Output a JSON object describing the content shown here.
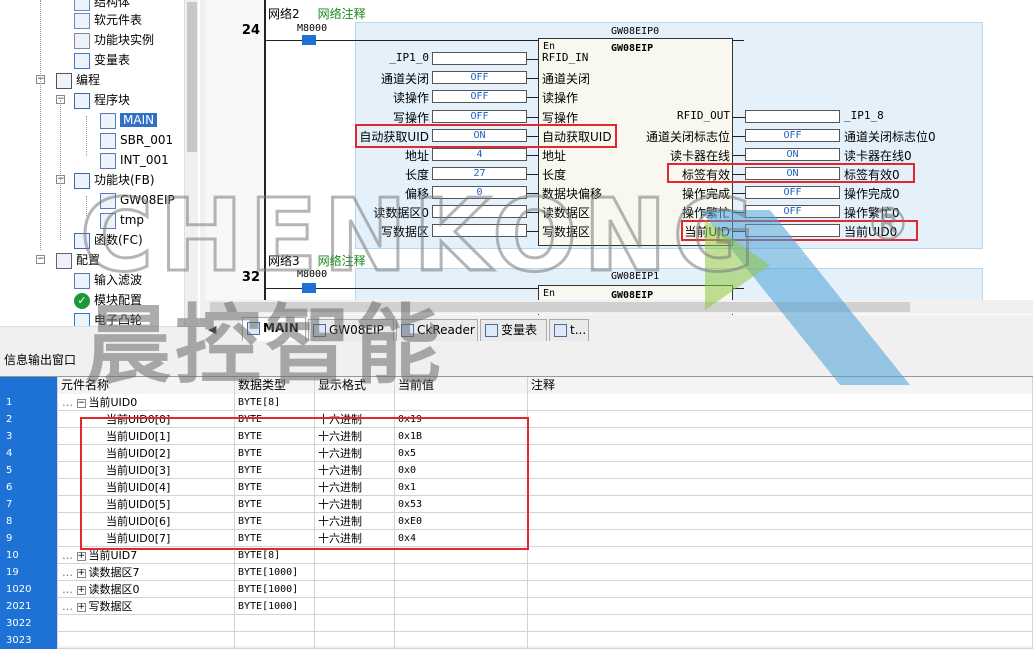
{
  "tree": {
    "items": [
      {
        "label": "结构体",
        "icon": "struct-icon"
      },
      {
        "label": "软元件表",
        "icon": "device-table-icon"
      },
      {
        "label": "功能块实例",
        "icon": "fb-instance-icon"
      },
      {
        "label": "变量表",
        "icon": "variable-table-icon"
      },
      {
        "label": "编程",
        "icon": "programming-icon"
      },
      {
        "label": "程序块",
        "icon": "program-block-icon"
      },
      {
        "label": "MAIN",
        "icon": "program-icon"
      },
      {
        "label": "SBR_001",
        "icon": "program-icon"
      },
      {
        "label": "INT_001",
        "icon": "program-icon"
      },
      {
        "label": "功能块(FB)",
        "icon": "function-block-icon"
      },
      {
        "label": "GW08EIP",
        "icon": "fb-icon"
      },
      {
        "label": "tmp",
        "icon": "fb-icon"
      },
      {
        "label": "函数(FC)",
        "icon": "function-icon"
      },
      {
        "label": "配置",
        "icon": "config-icon"
      },
      {
        "label": "输入滤波",
        "icon": "input-filter-icon"
      },
      {
        "label": "模块配置",
        "icon": "check-icon"
      },
      {
        "label": "电子凸轮",
        "icon": "cam-icon"
      }
    ]
  },
  "editor": {
    "network2": {
      "rung": "24",
      "label": "网络2",
      "comment": "网络注释",
      "contact": "M8000",
      "fb_instance": "GW08EIP0",
      "fb_type": "GW08EIP",
      "en": "En",
      "inputs": [
        {
          "var": "_IP1_0",
          "value": "",
          "pin": "RFID_IN"
        },
        {
          "var": "通道关闭",
          "value": "OFF",
          "pin": "通道关闭"
        },
        {
          "var": "读操作",
          "value": "OFF",
          "pin": "读操作"
        },
        {
          "var": "写操作",
          "value": "OFF",
          "pin": "写操作"
        },
        {
          "var": "自动获取UID",
          "value": "ON",
          "pin": "自动获取UID"
        },
        {
          "var": "地址",
          "value": "4",
          "pin": "地址"
        },
        {
          "var": "长度",
          "value": "27",
          "pin": "长度"
        },
        {
          "var": "偏移",
          "value": "0",
          "pin": "数据块偏移"
        },
        {
          "var": "读数据区0",
          "value": "",
          "pin": "读数据区"
        },
        {
          "var": "写数据区",
          "value": "",
          "pin": "写数据区"
        }
      ],
      "outputs": [
        {
          "pin": "RFID_OUT",
          "value": "",
          "var": "_IP1_8"
        },
        {
          "pin": "通道关闭标志位",
          "value": "OFF",
          "var": "通道关闭标志位0"
        },
        {
          "pin": "读卡器在线",
          "value": "ON",
          "var": "读卡器在线0"
        },
        {
          "pin": "标签有效",
          "value": "ON",
          "var": "标签有效0"
        },
        {
          "pin": "操作完成",
          "value": "OFF",
          "var": "操作完成0"
        },
        {
          "pin": "操作繁忙",
          "value": "OFF",
          "var": "操作繁忙0"
        },
        {
          "pin": "当前UID",
          "value": "",
          "var": "当前UID0"
        }
      ]
    },
    "network3": {
      "rung": "32",
      "label": "网络3",
      "comment": "网络注释",
      "contact": "M8000",
      "fb_instance": "GW08EIP1",
      "fb_type": "GW08EIP",
      "en": "En"
    }
  },
  "tabs": [
    {
      "label": "MAIN",
      "active": true
    },
    {
      "label": "GW08EIP",
      "active": false
    },
    {
      "label": "CkReader",
      "active": false
    },
    {
      "label": "变量表",
      "active": false
    },
    {
      "label": "t...",
      "active": false
    }
  ],
  "info_panel": {
    "title": "信息输出窗口",
    "columns": [
      "元件名称",
      "数据类型",
      "显示格式",
      "当前值",
      "注释"
    ],
    "rows": [
      {
        "no": "1",
        "name": "当前UID0",
        "type": "BYTE[8]",
        "fmt": "",
        "value": "",
        "level": 0,
        "expand": "−"
      },
      {
        "no": "2",
        "name": "当前UID0[0]",
        "type": "BYTE",
        "fmt": "十六进制",
        "value": "0x19",
        "level": 1,
        "expand": ""
      },
      {
        "no": "3",
        "name": "当前UID0[1]",
        "type": "BYTE",
        "fmt": "十六进制",
        "value": "0x1B",
        "level": 1,
        "expand": ""
      },
      {
        "no": "4",
        "name": "当前UID0[2]",
        "type": "BYTE",
        "fmt": "十六进制",
        "value": "0x5",
        "level": 1,
        "expand": ""
      },
      {
        "no": "5",
        "name": "当前UID0[3]",
        "type": "BYTE",
        "fmt": "十六进制",
        "value": "0x0",
        "level": 1,
        "expand": ""
      },
      {
        "no": "6",
        "name": "当前UID0[4]",
        "type": "BYTE",
        "fmt": "十六进制",
        "value": "0x1",
        "level": 1,
        "expand": ""
      },
      {
        "no": "7",
        "name": "当前UID0[5]",
        "type": "BYTE",
        "fmt": "十六进制",
        "value": "0x53",
        "level": 1,
        "expand": ""
      },
      {
        "no": "8",
        "name": "当前UID0[6]",
        "type": "BYTE",
        "fmt": "十六进制",
        "value": "0xE0",
        "level": 1,
        "expand": ""
      },
      {
        "no": "9",
        "name": "当前UID0[7]",
        "type": "BYTE",
        "fmt": "十六进制",
        "value": "0x4",
        "level": 1,
        "expand": ""
      },
      {
        "no": "10",
        "name": "当前UID7",
        "type": "BYTE[8]",
        "fmt": "",
        "value": "",
        "level": 0,
        "expand": "+"
      },
      {
        "no": "19",
        "name": "读数据区7",
        "type": "BYTE[1000]",
        "fmt": "",
        "value": "",
        "level": 0,
        "expand": "+"
      },
      {
        "no": "1020",
        "name": "读数据区0",
        "type": "BYTE[1000]",
        "fmt": "",
        "value": "",
        "level": 0,
        "expand": "+"
      },
      {
        "no": "2021",
        "name": "写数据区",
        "type": "BYTE[1000]",
        "fmt": "",
        "value": "",
        "level": 0,
        "expand": "+"
      },
      {
        "no": "3022",
        "name": "",
        "type": "",
        "fmt": "",
        "value": "",
        "level": 0,
        "expand": ""
      },
      {
        "no": "3023",
        "name": "",
        "type": "",
        "fmt": "",
        "value": "",
        "level": 0,
        "expand": ""
      }
    ]
  },
  "watermark": {
    "text_en": "CHENKONG",
    "text_cn": "晨控智能",
    "mark": "®"
  },
  "colors": {
    "selection": "#1e72d6",
    "highlight_box": "#e0282e",
    "rung_background": "#e4f1fb",
    "comment_green": "#1a8a1a",
    "value_blue": "#2060c0"
  }
}
